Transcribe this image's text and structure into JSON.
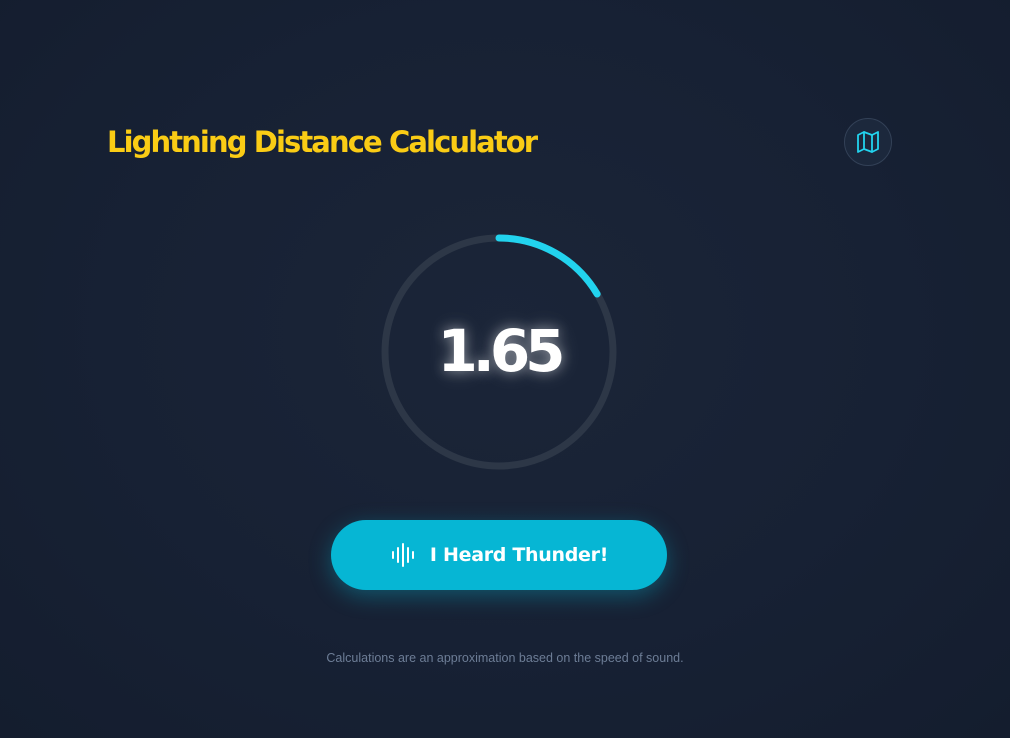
{
  "header": {
    "title": "Lightning Distance Calculator",
    "map_button_icon": "map-icon"
  },
  "gauge": {
    "value": "1.65",
    "progress": 0.165
  },
  "action": {
    "label": "I Heard Thunder!",
    "icon": "sound-wave-icon"
  },
  "footer": {
    "note": "Calculations are an approximation based on the speed of sound."
  },
  "colors": {
    "title": "#facc15",
    "accent": "#22d3ee",
    "button": "#06b6d4",
    "track": "#2d3747",
    "background": "#172134"
  }
}
